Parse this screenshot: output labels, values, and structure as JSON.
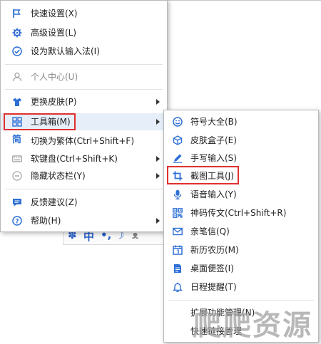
{
  "colors": {
    "accent": "#2e6fd6",
    "highlight": "#e6eef9",
    "annotation": "#e03030",
    "disabled": "#888888"
  },
  "main_menu": {
    "items": [
      {
        "label": "快速设置(X)",
        "icon": "flag-icon"
      },
      {
        "label": "高级设置(L)",
        "icon": "gear-icon"
      },
      {
        "label": "设为默认输入法(I)",
        "icon": "check-circle-icon"
      },
      {
        "label": "个人中心(U)",
        "icon": "user-icon"
      },
      {
        "label": "更换皮肤(P)",
        "icon": "shirt-icon"
      },
      {
        "label": "工具箱(M)",
        "icon": "grid-icon"
      },
      {
        "label": "切换为繁体(Ctrl+Shift+F)",
        "icon": "traditional-char-icon",
        "icon_text": "简"
      },
      {
        "label": "软键盘(Ctrl+Shift+K)",
        "icon": "keyboard-icon"
      },
      {
        "label": "隐藏状态栏(Y)",
        "icon": "minus-circle-icon"
      },
      {
        "label": "反馈建议(Z)",
        "icon": "chat-icon"
      },
      {
        "label": "帮助(H)",
        "icon": "help-icon"
      }
    ]
  },
  "toolbox_submenu": {
    "items": [
      {
        "label": "符号大全(B)",
        "icon": "smiley-icon"
      },
      {
        "label": "皮肤盒子(E)",
        "icon": "cube-icon"
      },
      {
        "label": "手写输入(S)",
        "icon": "pen-icon"
      },
      {
        "label": "截图工具(J)",
        "icon": "crop-icon"
      },
      {
        "label": "语音输入(Y)",
        "icon": "microphone-icon"
      },
      {
        "label": "神码传文(Ctrl+Shift+R)",
        "icon": "qr-icon"
      },
      {
        "label": "亲笔信(Q)",
        "icon": "envelope-icon"
      },
      {
        "label": "新历农历(M)",
        "icon": "calendar-icon"
      },
      {
        "label": "桌面便签(I)",
        "icon": "note-icon"
      },
      {
        "label": "日程提醒(T)",
        "icon": "bell-icon"
      },
      {
        "label": "扩展功能管理(N)",
        "icon": "none"
      },
      {
        "label": "快速链接管理",
        "icon": "none"
      }
    ]
  },
  "status_bar": {
    "mode_char": "中"
  },
  "watermark": "爬爬资源"
}
